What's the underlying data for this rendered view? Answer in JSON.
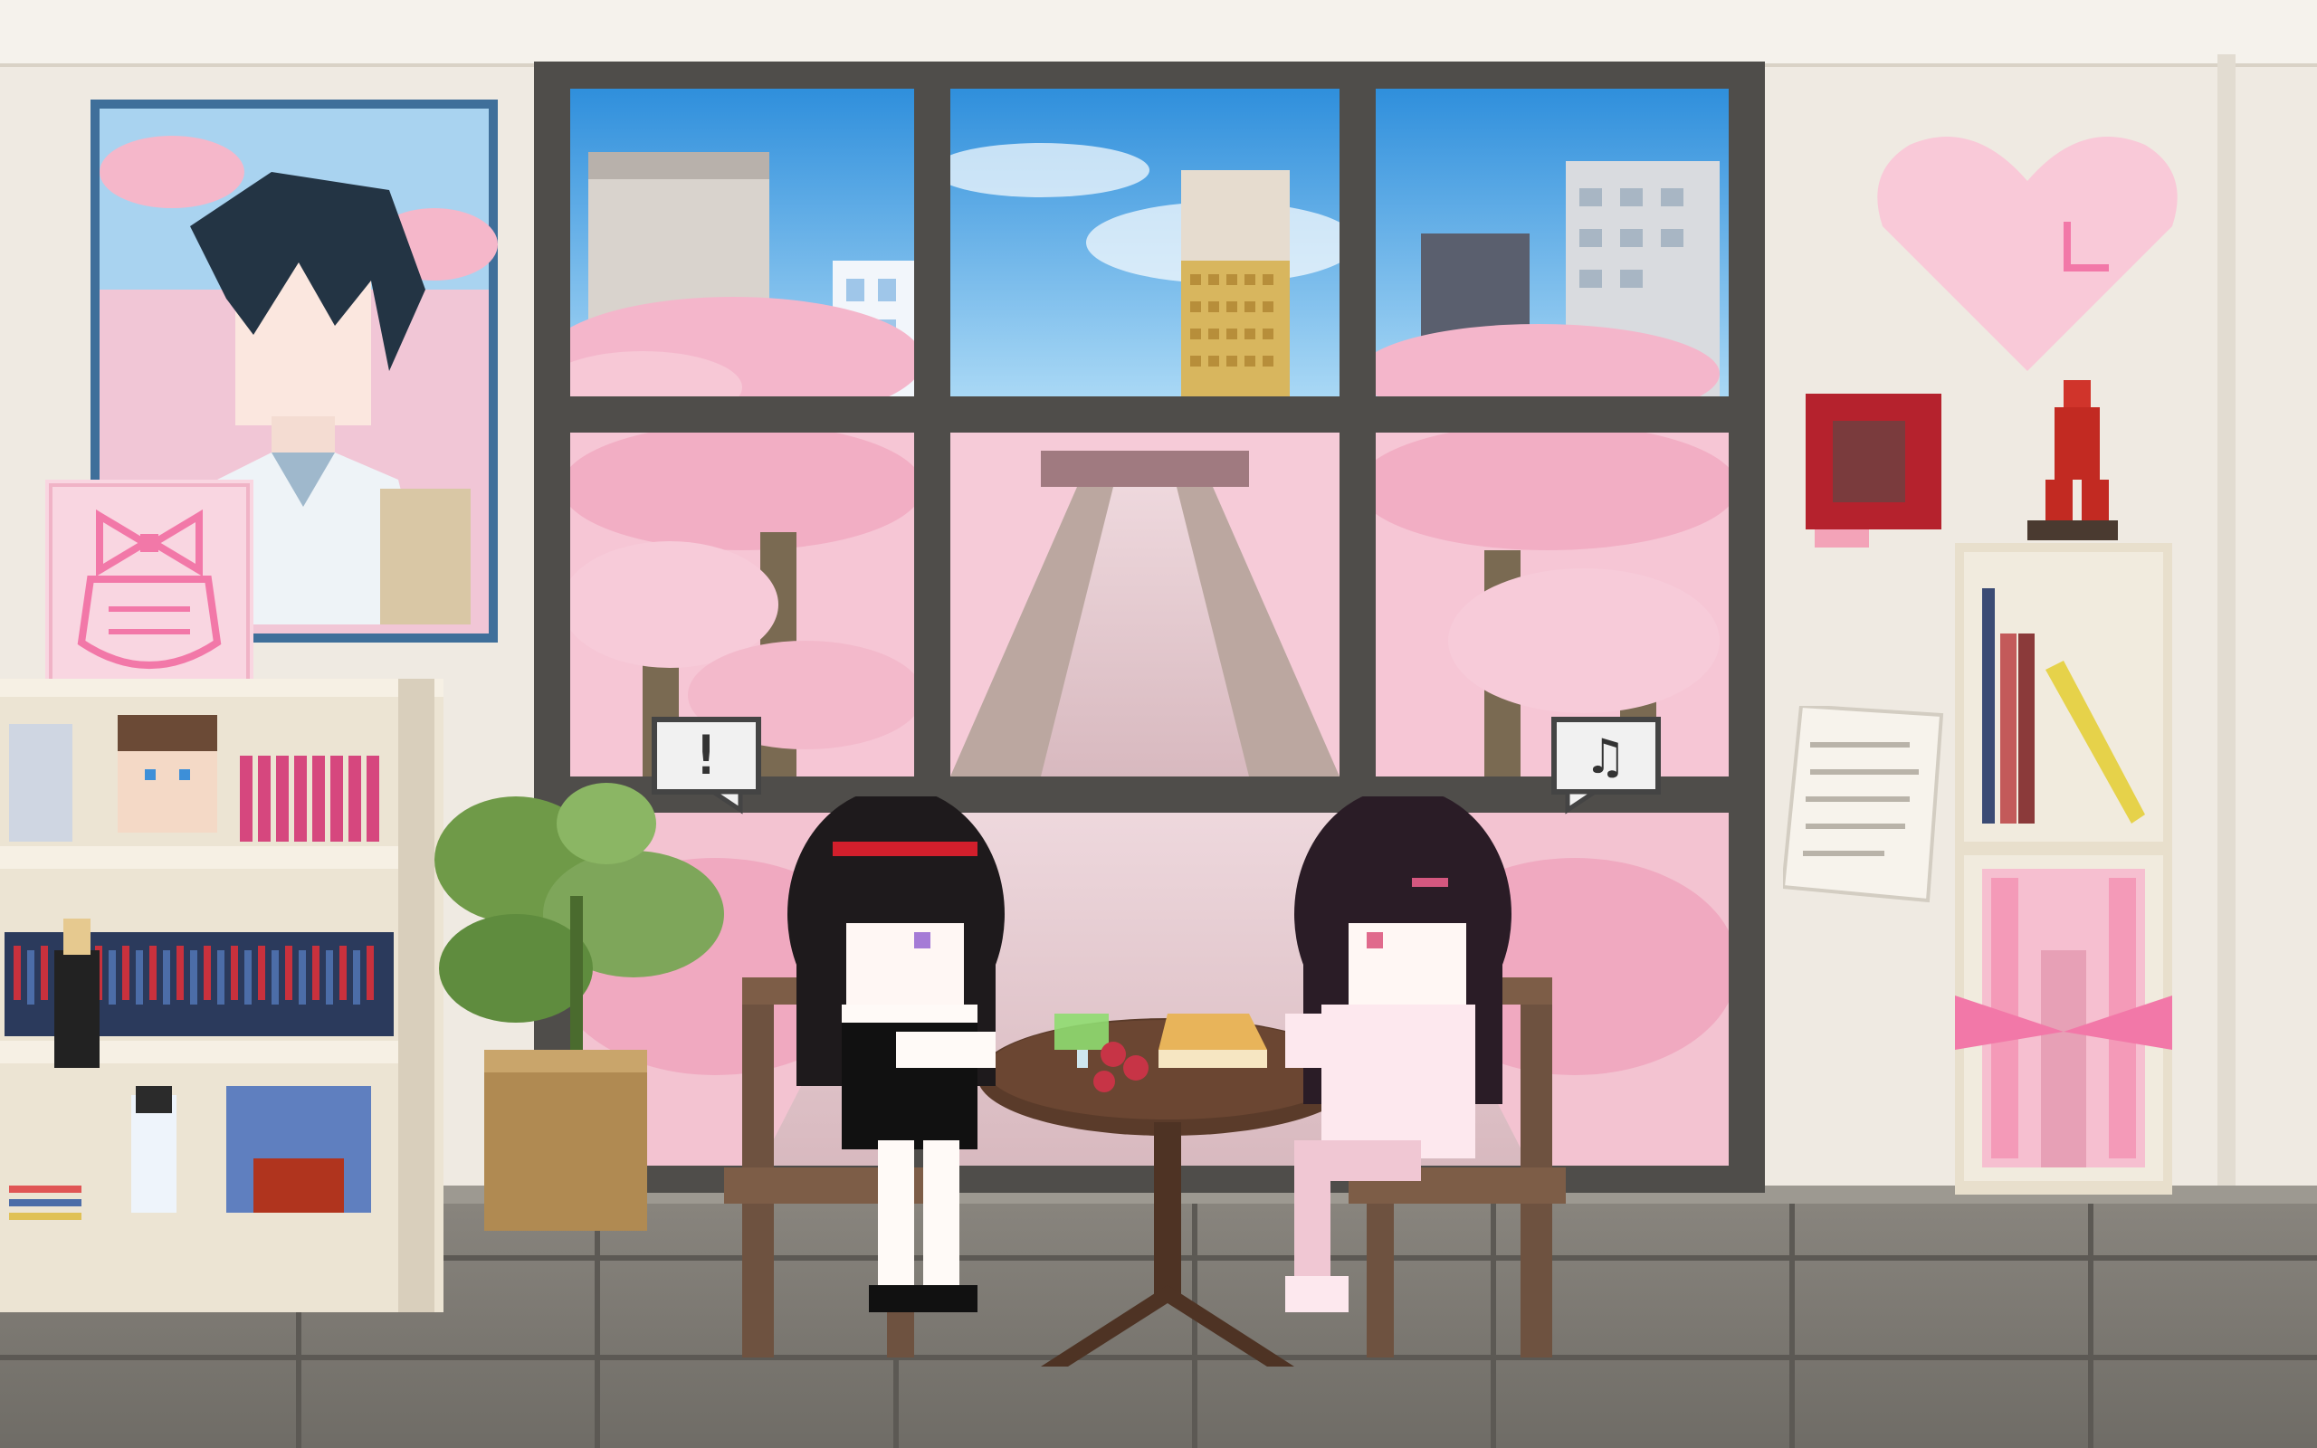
{
  "scene": {
    "type": "pixel-art room scene",
    "colors": {
      "wall": "#efeae2",
      "ceiling": "#f6f3ee",
      "floor": "#7f7c76",
      "window_frame": "#4f4d4a",
      "sky": "#5aa9e6",
      "blossom": "#f5b8cc",
      "table": "#5a3b2a"
    }
  },
  "bubbles": {
    "left": {
      "icon": "exclamation-icon",
      "glyph": "!"
    },
    "right": {
      "icon": "music-note-icon",
      "glyph": "♫"
    }
  }
}
